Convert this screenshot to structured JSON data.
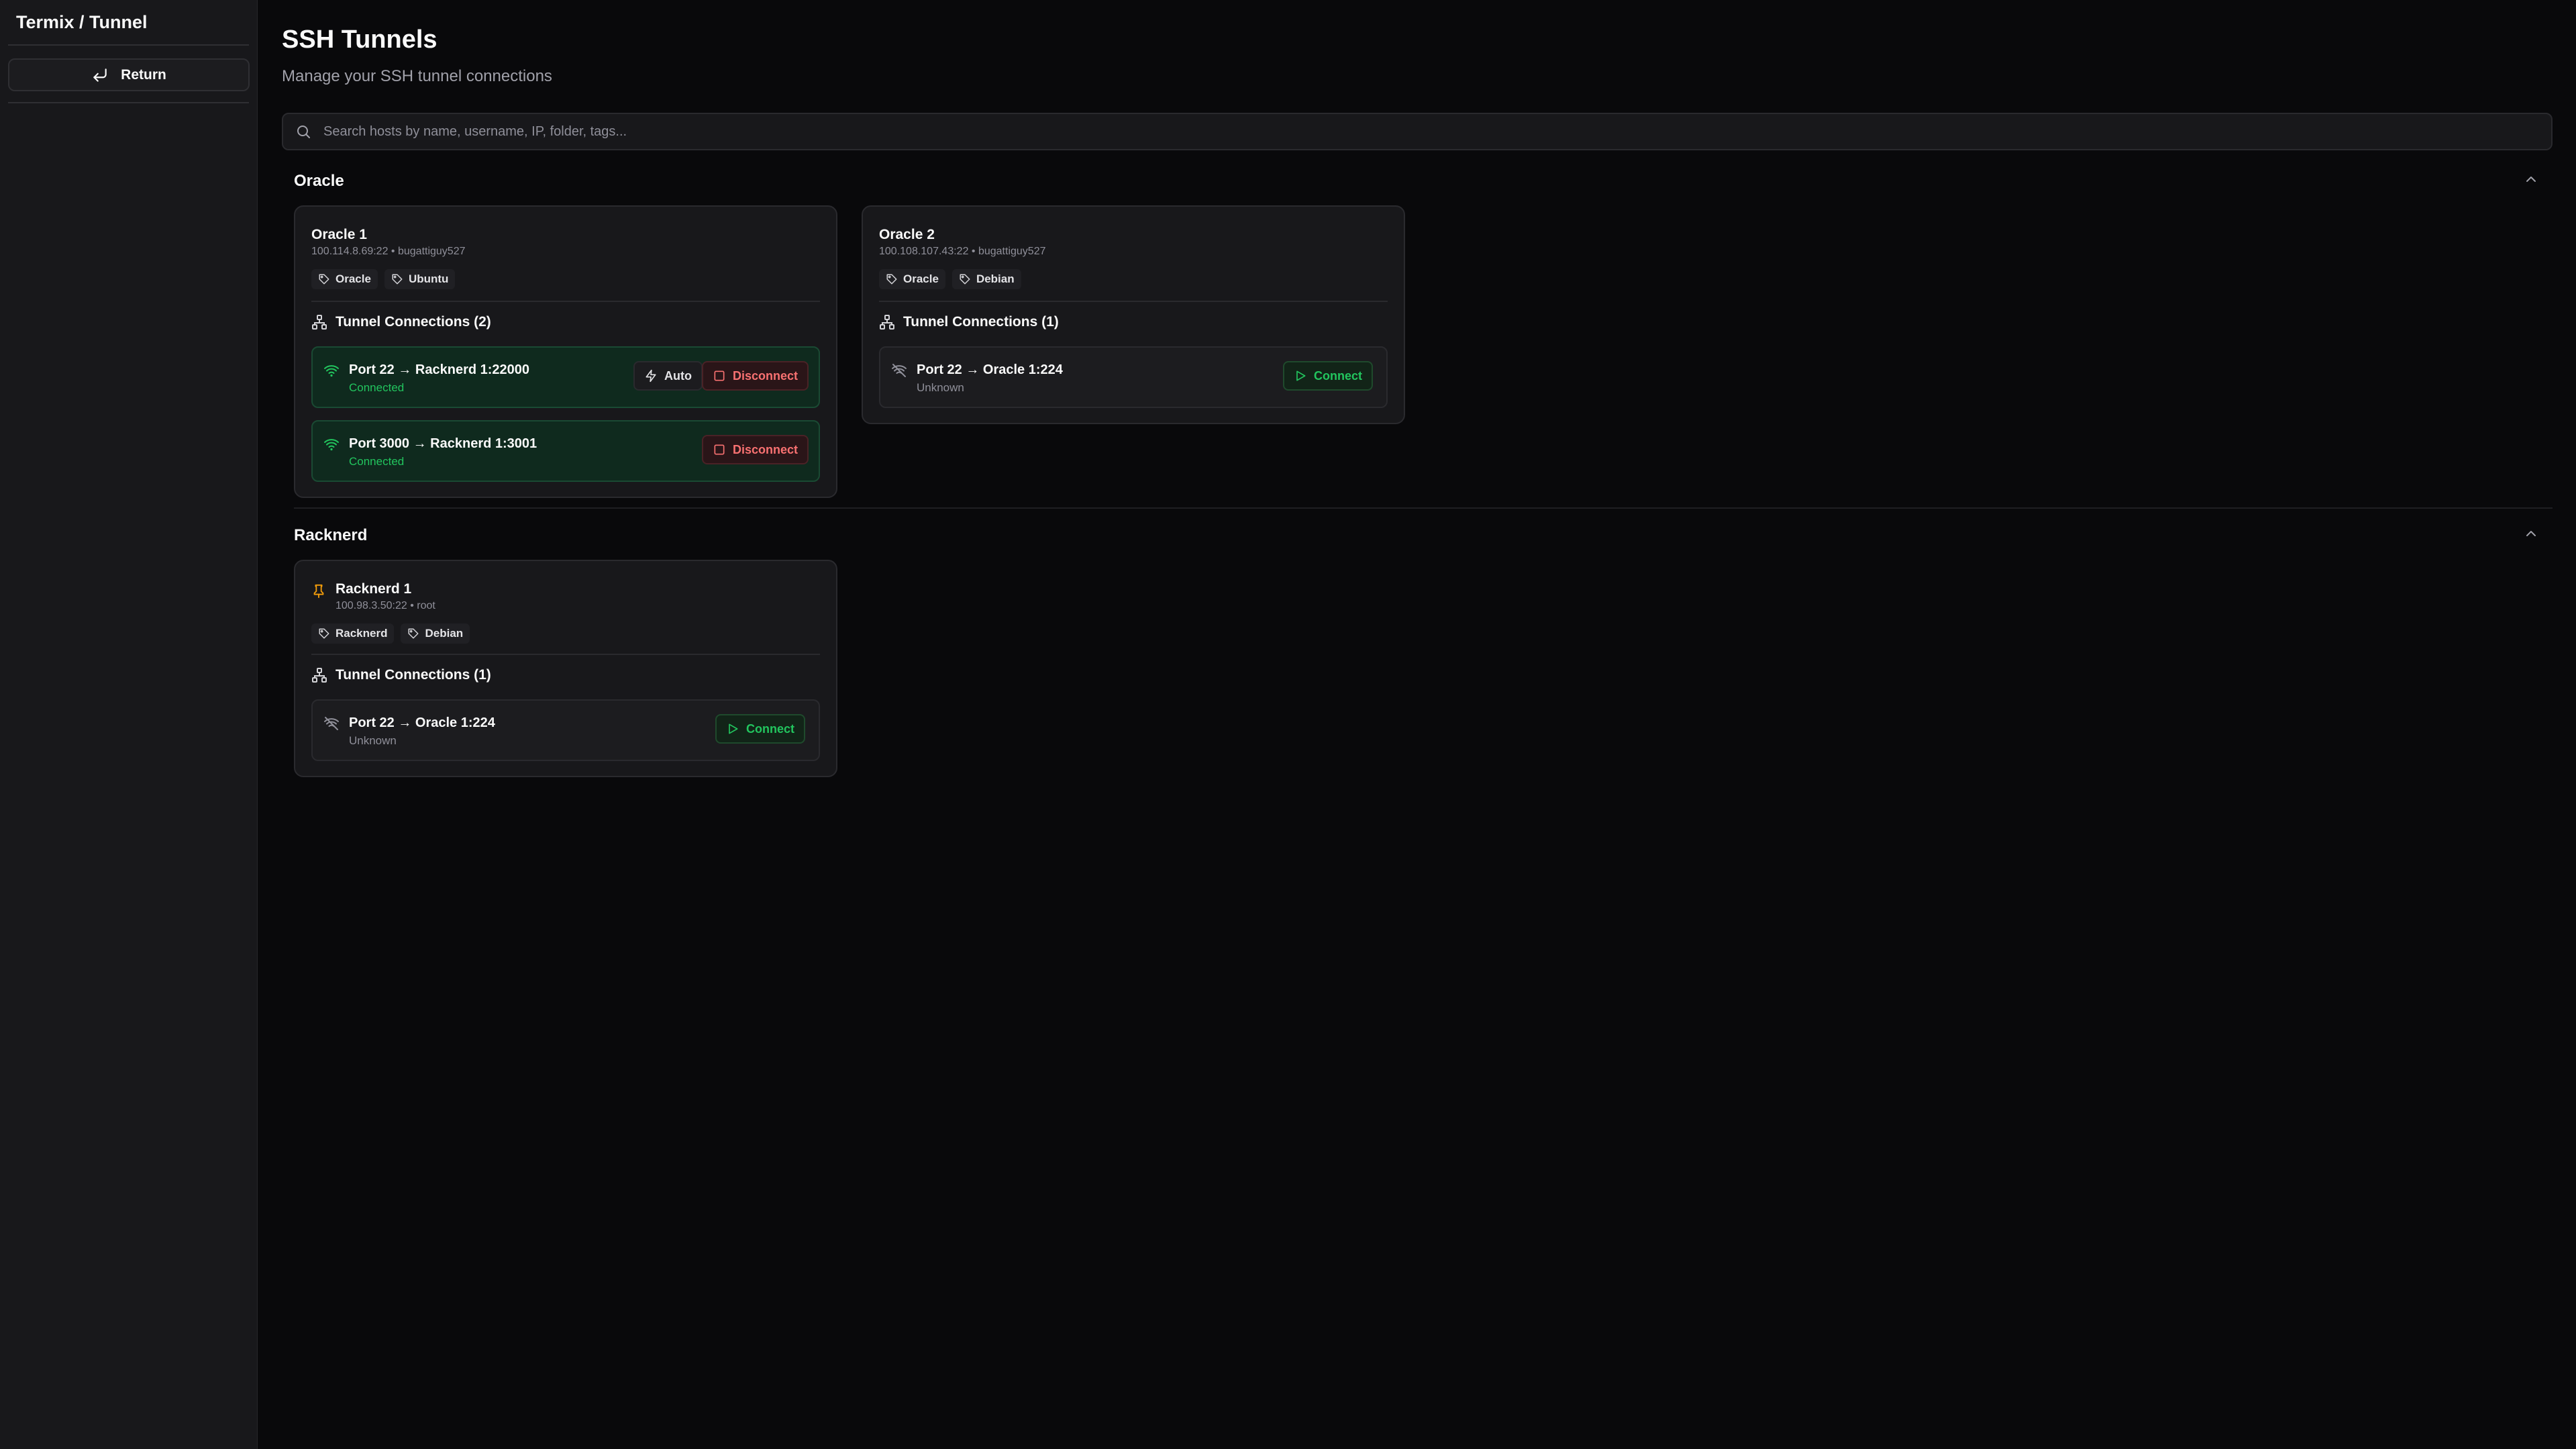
{
  "sidebar": {
    "title": "Termix / Tunnel",
    "return_label": "Return"
  },
  "header": {
    "title": "SSH Tunnels",
    "subtitle": "Manage your SSH tunnel connections"
  },
  "search": {
    "placeholder": "Search hosts by name, username, IP, folder, tags..."
  },
  "colors": {
    "background": "#09090b",
    "sidebar": "#18181b",
    "connected": "#22c55e",
    "disconnect": "#f87171",
    "pin": "#f59e0b"
  },
  "folders": [
    {
      "name": "Oracle",
      "hosts": [
        {
          "name": "Oracle 1",
          "meta": "100.114.8.69:22 • bugattiguy527",
          "tags": [
            "Oracle",
            "Ubuntu"
          ],
          "tunnels_header": "Tunnel Connections (2)",
          "tunnels": [
            {
              "label": "Port 22 → Racknerd 1:22000",
              "status": "Connected",
              "auto_label": "Auto",
              "action": "Disconnect"
            },
            {
              "label": "Port 3000 → Racknerd 1:3001",
              "status": "Connected",
              "action": "Disconnect"
            }
          ]
        },
        {
          "name": "Oracle 2",
          "meta": "100.108.107.43:22 • bugattiguy527",
          "tags": [
            "Oracle",
            "Debian"
          ],
          "tunnels_header": "Tunnel Connections (1)",
          "tunnels": [
            {
              "label": "Port 22 → Oracle 1:224",
              "status": "Unknown",
              "action": "Connect"
            }
          ]
        }
      ]
    },
    {
      "name": "Racknerd",
      "hosts": [
        {
          "name": "Racknerd 1",
          "meta": "100.98.3.50:22 • root",
          "pinned": true,
          "tags": [
            "Racknerd",
            "Debian"
          ],
          "tunnels_header": "Tunnel Connections (1)",
          "tunnels": [
            {
              "label": "Port 22 → Oracle 1:224",
              "status": "Unknown",
              "action": "Connect"
            }
          ]
        }
      ]
    }
  ]
}
